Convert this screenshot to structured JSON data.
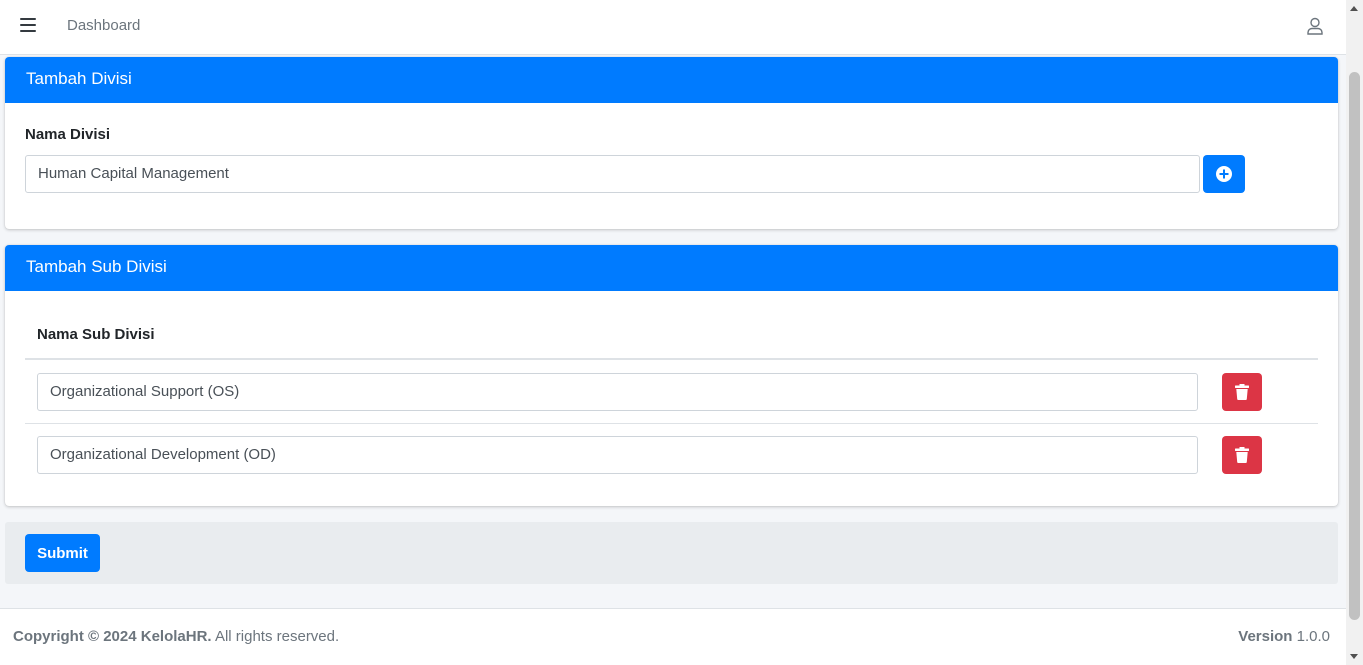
{
  "navbar": {
    "menu_icon": "hamburger-icon",
    "link_label": "Dashboard",
    "user_icon": "user-icon"
  },
  "divisi_card": {
    "title": "Tambah Divisi",
    "field_label": "Nama Divisi",
    "field_value": "Human Capital Management",
    "add_icon": "plus-circle-icon"
  },
  "sub_divisi_card": {
    "title": "Tambah Sub Divisi",
    "column_header": "Nama Sub Divisi",
    "rows": [
      {
        "value": "Organizational Support (OS)",
        "delete_icon": "trash-icon"
      },
      {
        "value": "Organizational Development (OD)",
        "delete_icon": "trash-icon"
      }
    ]
  },
  "form_footer": {
    "submit_label": "Submit"
  },
  "footer": {
    "copyright_prefix": "Copyright © 2024 KelolaHR.",
    "copyright_suffix": " All rights reserved.",
    "version_label": "Version",
    "version_value": " 1.0.0"
  },
  "colors": {
    "primary": "#007bff",
    "danger": "#dc3545",
    "background": "#f4f6f9"
  }
}
